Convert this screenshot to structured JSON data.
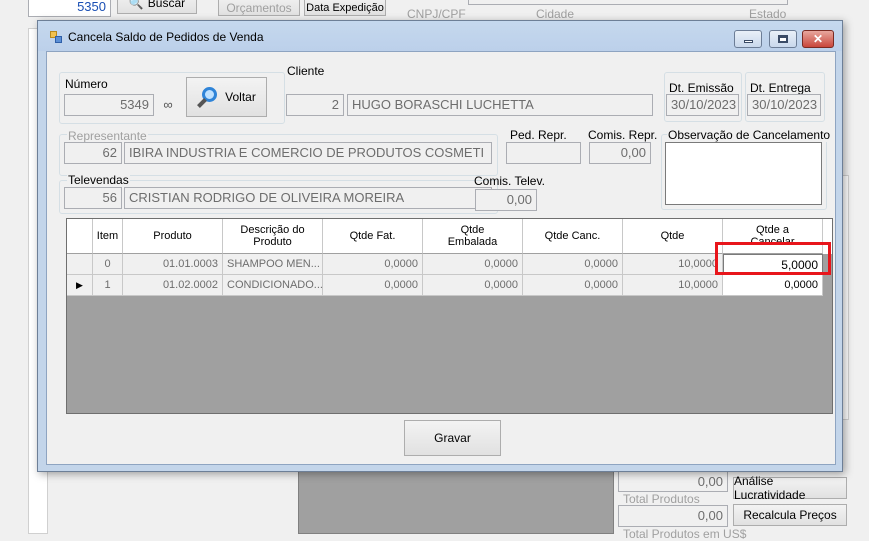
{
  "background": {
    "order_number": "5350",
    "buscar_label": "Buscar",
    "orcamentos_label": "Orçamentos",
    "data_expedicao_label": "Data Expedição",
    "cnpj_label": "CNPJ/CPF",
    "cidade_label": "Cidade",
    "estado_label": "Estado",
    "total_produtos_value": "0,00",
    "total_produtos_label": "Total Produtos",
    "total_produtos_us_value": "0,00",
    "total_produtos_us_label": "Total Produtos em US$",
    "analise_label": "Análise Lucratividade",
    "recalcula_label": "Recalcula Preços"
  },
  "dialog": {
    "title": "Cancela Saldo de Pedidos de Venda",
    "numero_label": "Número",
    "numero_value": "5349",
    "voltar_label": "Voltar",
    "cliente_label": "Cliente",
    "cliente_code": "2",
    "cliente_name": "HUGO BORASCHI LUCHETTA",
    "dt_emissao_label": "Dt. Emissão",
    "dt_emissao_value": "30/10/2023",
    "dt_entrega_label": "Dt. Entrega",
    "dt_entrega_value": "30/10/2023",
    "representante_label": "Representante",
    "representante_code": "62",
    "representante_name": "IBIRA INDUSTRIA E COMERCIO DE PRODUTOS COSMETI",
    "ped_repr_label": "Ped. Repr.",
    "ped_repr_value": "",
    "comis_repr_label": "Comis. Repr.",
    "comis_repr_value": "0,00",
    "obs_label": "Observação de Cancelamento",
    "obs_value": "",
    "televendas_label": "Televendas",
    "televendas_code": "56",
    "televendas_name": "CRISTIAN RODRIGO DE OLIVEIRA MOREIRA",
    "comis_telev_label": "Comis. Telev.",
    "comis_telev_value": "0,00",
    "gravar_label": "Gravar"
  },
  "grid": {
    "columns": [
      "Item",
      "Produto",
      "Descrição do Produto",
      "Qtde Fat.",
      "Qtde Embalada",
      "Qtde Canc.",
      "Qtde",
      "Qtde a Cancelar"
    ],
    "rows": [
      {
        "item": "0",
        "produto": "01.01.0003",
        "descricao": "SHAMPOO MEN...",
        "qtde_fat": "0,0000",
        "qtde_embalada": "0,0000",
        "qtde_canc": "0,0000",
        "qtde": "10,0000",
        "qtde_cancelar": "5,0000"
      },
      {
        "item": "1",
        "produto": "01.02.0002",
        "descricao": "CONDICIONADO...",
        "qtde_fat": "0,0000",
        "qtde_embalada": "0,0000",
        "qtde_canc": "0,0000",
        "qtde": "10,0000",
        "qtde_cancelar": "0,0000"
      }
    ]
  },
  "colors": {
    "highlight": "#e8151b",
    "titlebar": "#c5d8ee",
    "close_button": "#d9544b"
  }
}
